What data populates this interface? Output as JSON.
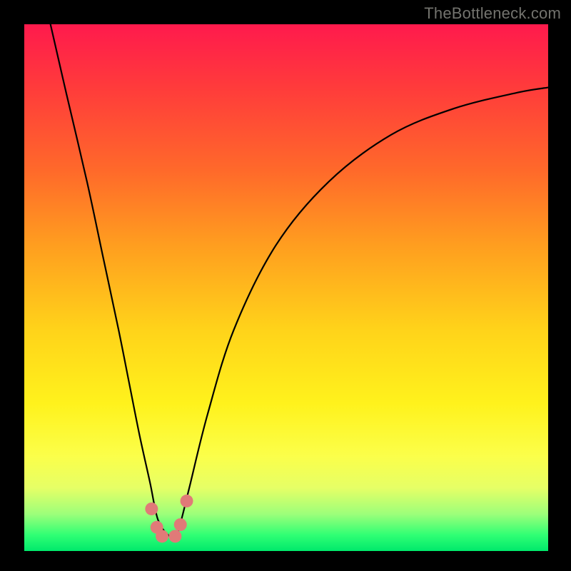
{
  "watermark": "TheBottleneck.com",
  "chart_data": {
    "type": "line",
    "title": "",
    "xlabel": "",
    "ylabel": "",
    "xlim": [
      0,
      100
    ],
    "ylim": [
      0,
      100
    ],
    "grid": false,
    "legend": false,
    "background_gradient": {
      "top": "#ff1a4d",
      "bottom": "#00e96b"
    },
    "series": [
      {
        "name": "bottleneck-curve",
        "color": "#000000",
        "x": [
          5,
          8,
          12,
          15,
          18,
          20,
          22,
          24,
          25.5,
          27.5,
          29,
          30,
          31.5,
          35,
          40,
          48,
          58,
          70,
          82,
          94,
          100
        ],
        "y": [
          100,
          87,
          70,
          56,
          42,
          32,
          22,
          13,
          6,
          3,
          3,
          6,
          12,
          26,
          42,
          58,
          70,
          79,
          84,
          87,
          88
        ]
      }
    ],
    "markers": {
      "name": "highlight-dots",
      "color": "#e07a78",
      "radius_px": 9,
      "points": [
        {
          "x": 24.3,
          "y": 8.0
        },
        {
          "x": 25.3,
          "y": 4.5
        },
        {
          "x": 26.3,
          "y": 2.8
        },
        {
          "x": 28.8,
          "y": 2.8
        },
        {
          "x": 29.8,
          "y": 5.0
        },
        {
          "x": 31.0,
          "y": 9.5
        }
      ]
    }
  }
}
